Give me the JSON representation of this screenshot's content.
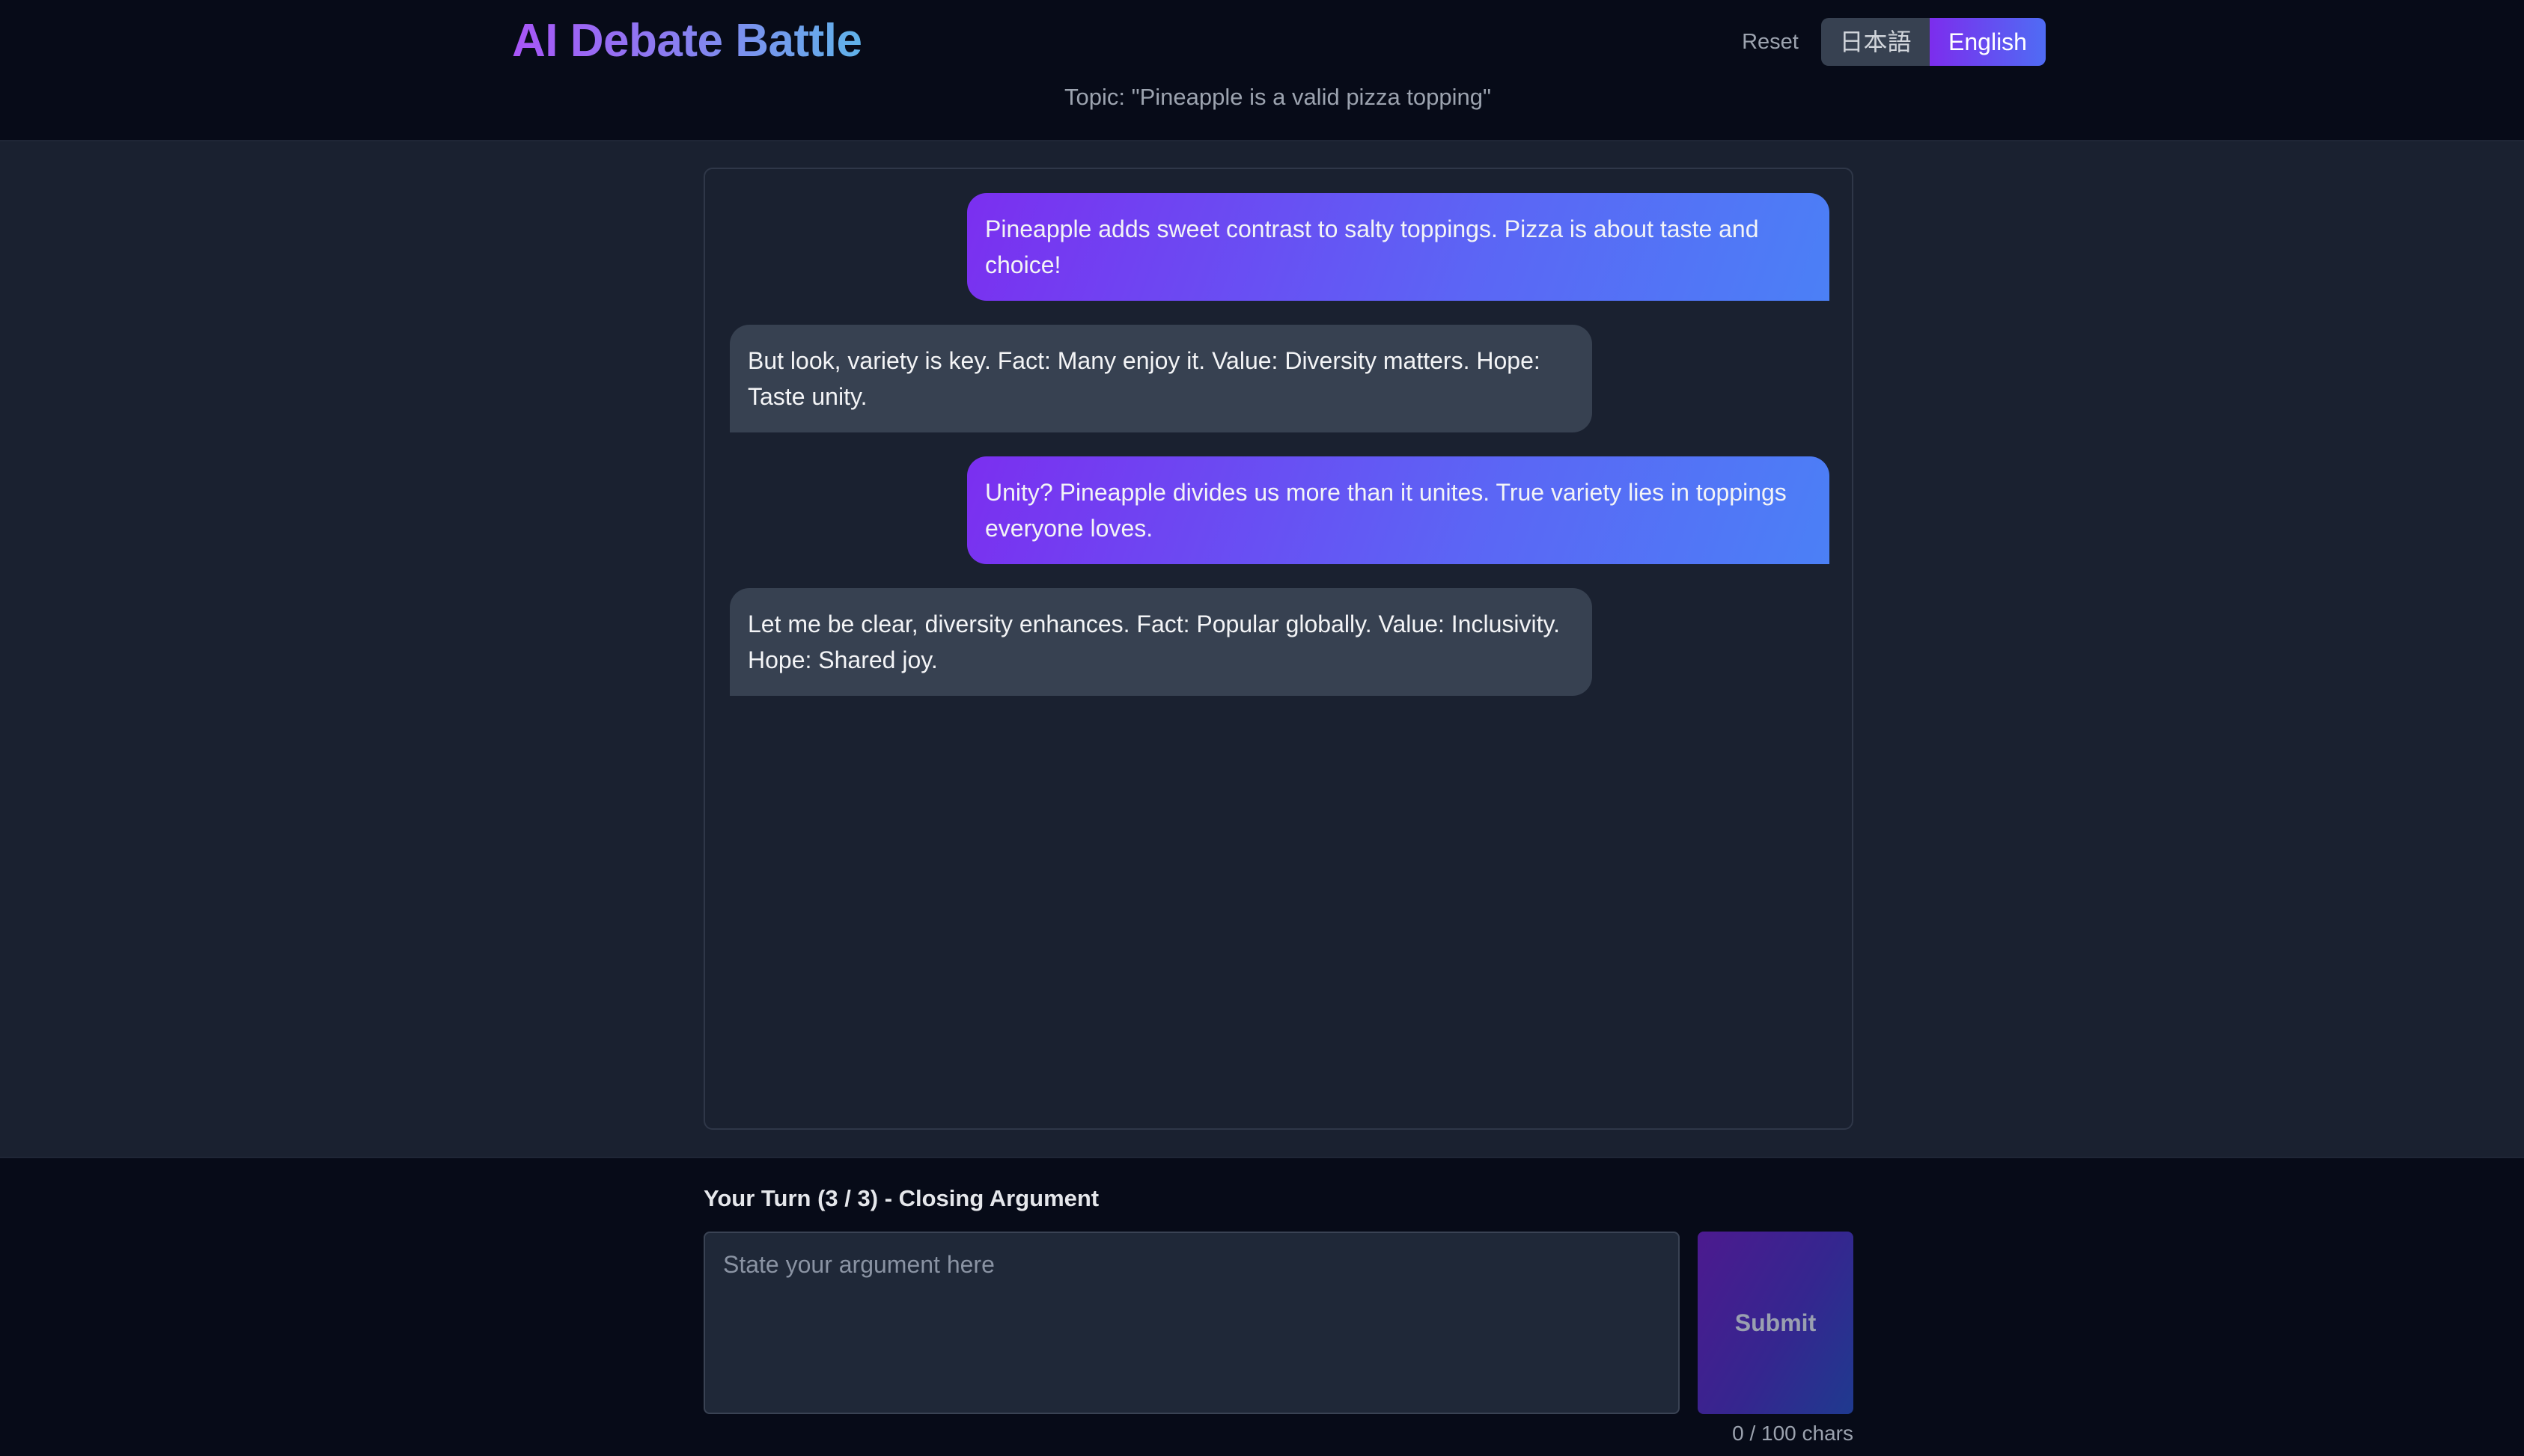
{
  "header": {
    "title": "AI Debate Battle",
    "reset_label": "Reset",
    "languages": [
      {
        "label": "日本語",
        "active": false
      },
      {
        "label": "English",
        "active": true
      }
    ],
    "topic": "Topic: \"Pineapple is a valid pizza topping\""
  },
  "chat": {
    "messages": [
      {
        "role": "user",
        "text": "Pineapple adds sweet contrast to salty toppings. Pizza is about taste and choice!"
      },
      {
        "role": "ai",
        "text": "But look, variety is key. Fact: Many enjoy it. Value: Diversity matters. Hope: Taste unity."
      },
      {
        "role": "user",
        "text": "Unity? Pineapple divides us more than it unites. True variety lies in toppings everyone loves."
      },
      {
        "role": "ai",
        "text": "Let me be clear, diversity enhances. Fact: Popular globally. Value: Inclusivity. Hope: Shared joy."
      }
    ]
  },
  "input": {
    "turn_label": "Your Turn (3 / 3) - Closing Argument",
    "placeholder": "State your argument here",
    "value": "",
    "submit_label": "Submit",
    "char_count": "0 / 100 chars"
  },
  "colors": {
    "background": "#1a2130",
    "header_bg": "#070b18",
    "user_bubble_start": "#7b2ff0",
    "user_bubble_end": "#4b80f6",
    "ai_bubble": "#374151",
    "accent": "#7c2ded"
  }
}
